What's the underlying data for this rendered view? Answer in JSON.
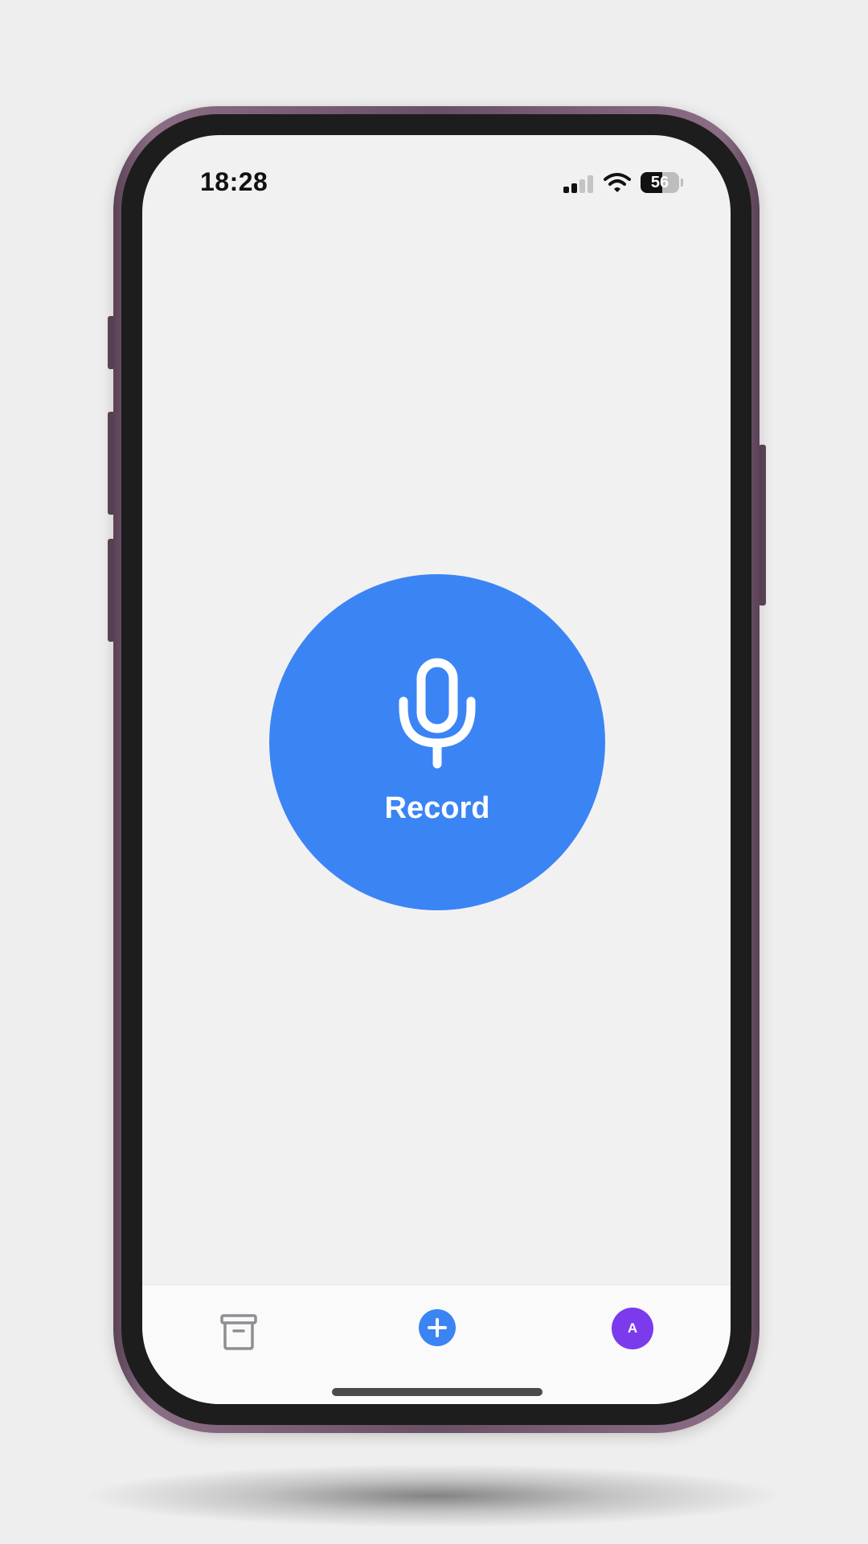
{
  "status_bar": {
    "time": "18:28",
    "battery_percent": "56",
    "battery_level": 0.56,
    "signal_bars_active": 2,
    "signal_bars_total": 4
  },
  "main": {
    "record_label": "Record",
    "record_icon": "microphone-icon",
    "record_color": "#3b84f4"
  },
  "tabbar": {
    "left_icon": "archive-box-icon",
    "center_icon": "plus-icon",
    "center_color": "#3b84f4",
    "avatar_initial": "A",
    "avatar_color": "#7c3aed"
  }
}
